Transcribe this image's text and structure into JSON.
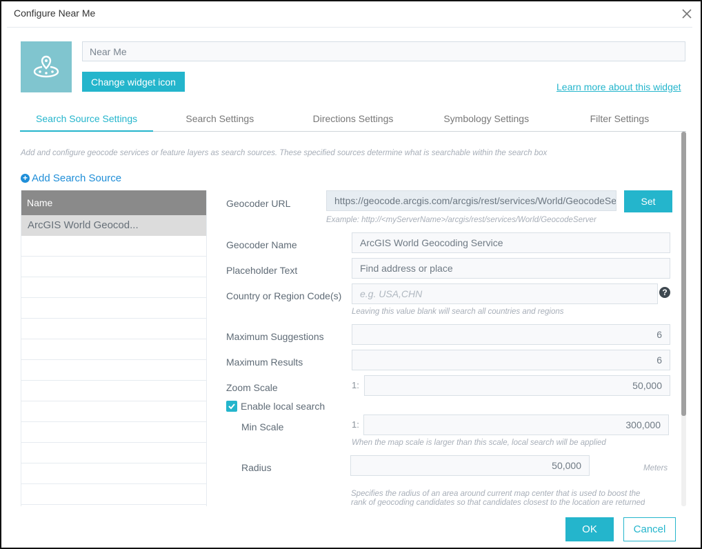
{
  "dialog": {
    "title": "Configure Near Me",
    "close_icon": "close-icon"
  },
  "widget": {
    "name": "Near Me",
    "icon": "location-radius-icon",
    "icon_bg_color": "#80c5cf",
    "change_icon_label": "Change widget icon",
    "learn_more_label": "Learn more about this widget"
  },
  "tabs": [
    {
      "label": "Search Source Settings",
      "active": true
    },
    {
      "label": "Search Settings",
      "active": false
    },
    {
      "label": "Directions Settings",
      "active": false
    },
    {
      "label": "Symbology Settings",
      "active": false
    },
    {
      "label": "Filter Settings",
      "active": false
    }
  ],
  "description": "Add and configure geocode services or feature layers as search sources. These specified sources determine what is searchable within the search box",
  "add_source": {
    "icon": "plus-circle-icon",
    "label": "Add Search Source"
  },
  "sources_list": {
    "header": "Name",
    "rows": [
      "ArcGIS World Geocod...",
      "",
      "",
      "",
      "",
      "",
      "",
      "",
      "",
      "",
      "",
      "",
      "",
      ""
    ]
  },
  "form": {
    "geocoder_url": {
      "label": "Geocoder URL",
      "value": "https://geocode.arcgis.com/arcgis/rest/services/World/GeocodeServer",
      "hint": "Example: http://<myServerName>/arcgis/rest/services/World/GeocodeServer",
      "set_label": "Set"
    },
    "geocoder_name": {
      "label": "Geocoder Name",
      "value": "ArcGIS World Geocoding Service"
    },
    "placeholder_text": {
      "label": "Placeholder Text",
      "value": "Find address or place"
    },
    "country_code": {
      "label": "Country or Region Code(s)",
      "placeholder": "e.g. USA,CHN",
      "hint": "Leaving this value blank will search all countries and regions",
      "help_icon": "question-circle-icon"
    },
    "max_suggestions": {
      "label": "Maximum Suggestions",
      "value": "6"
    },
    "max_results": {
      "label": "Maximum Results",
      "value": "6"
    },
    "zoom_scale": {
      "label": "Zoom Scale",
      "prefix": "1:",
      "value": "50,000"
    },
    "enable_local_search": {
      "label": "Enable local search",
      "checked": true
    },
    "min_scale": {
      "label": "Min Scale",
      "prefix": "1:",
      "value": "300,000",
      "hint": "When the map scale is larger than this scale, local search will be applied"
    },
    "radius": {
      "label": "Radius",
      "value": "50,000",
      "unit": "Meters",
      "hint_line1": "Specifies the radius of an area around current map center that is used to boost the",
      "hint_line2": "rank of geocoding candidates so that candidates closest to the location are returned"
    }
  },
  "footer": {
    "ok_label": "OK",
    "cancel_label": "Cancel"
  },
  "colors": {
    "accent": "#24b5cc",
    "link_blue": "#1f8ed8",
    "list_header_bg": "#8a8a8a",
    "selected_row_bg": "#dcdcdc"
  }
}
